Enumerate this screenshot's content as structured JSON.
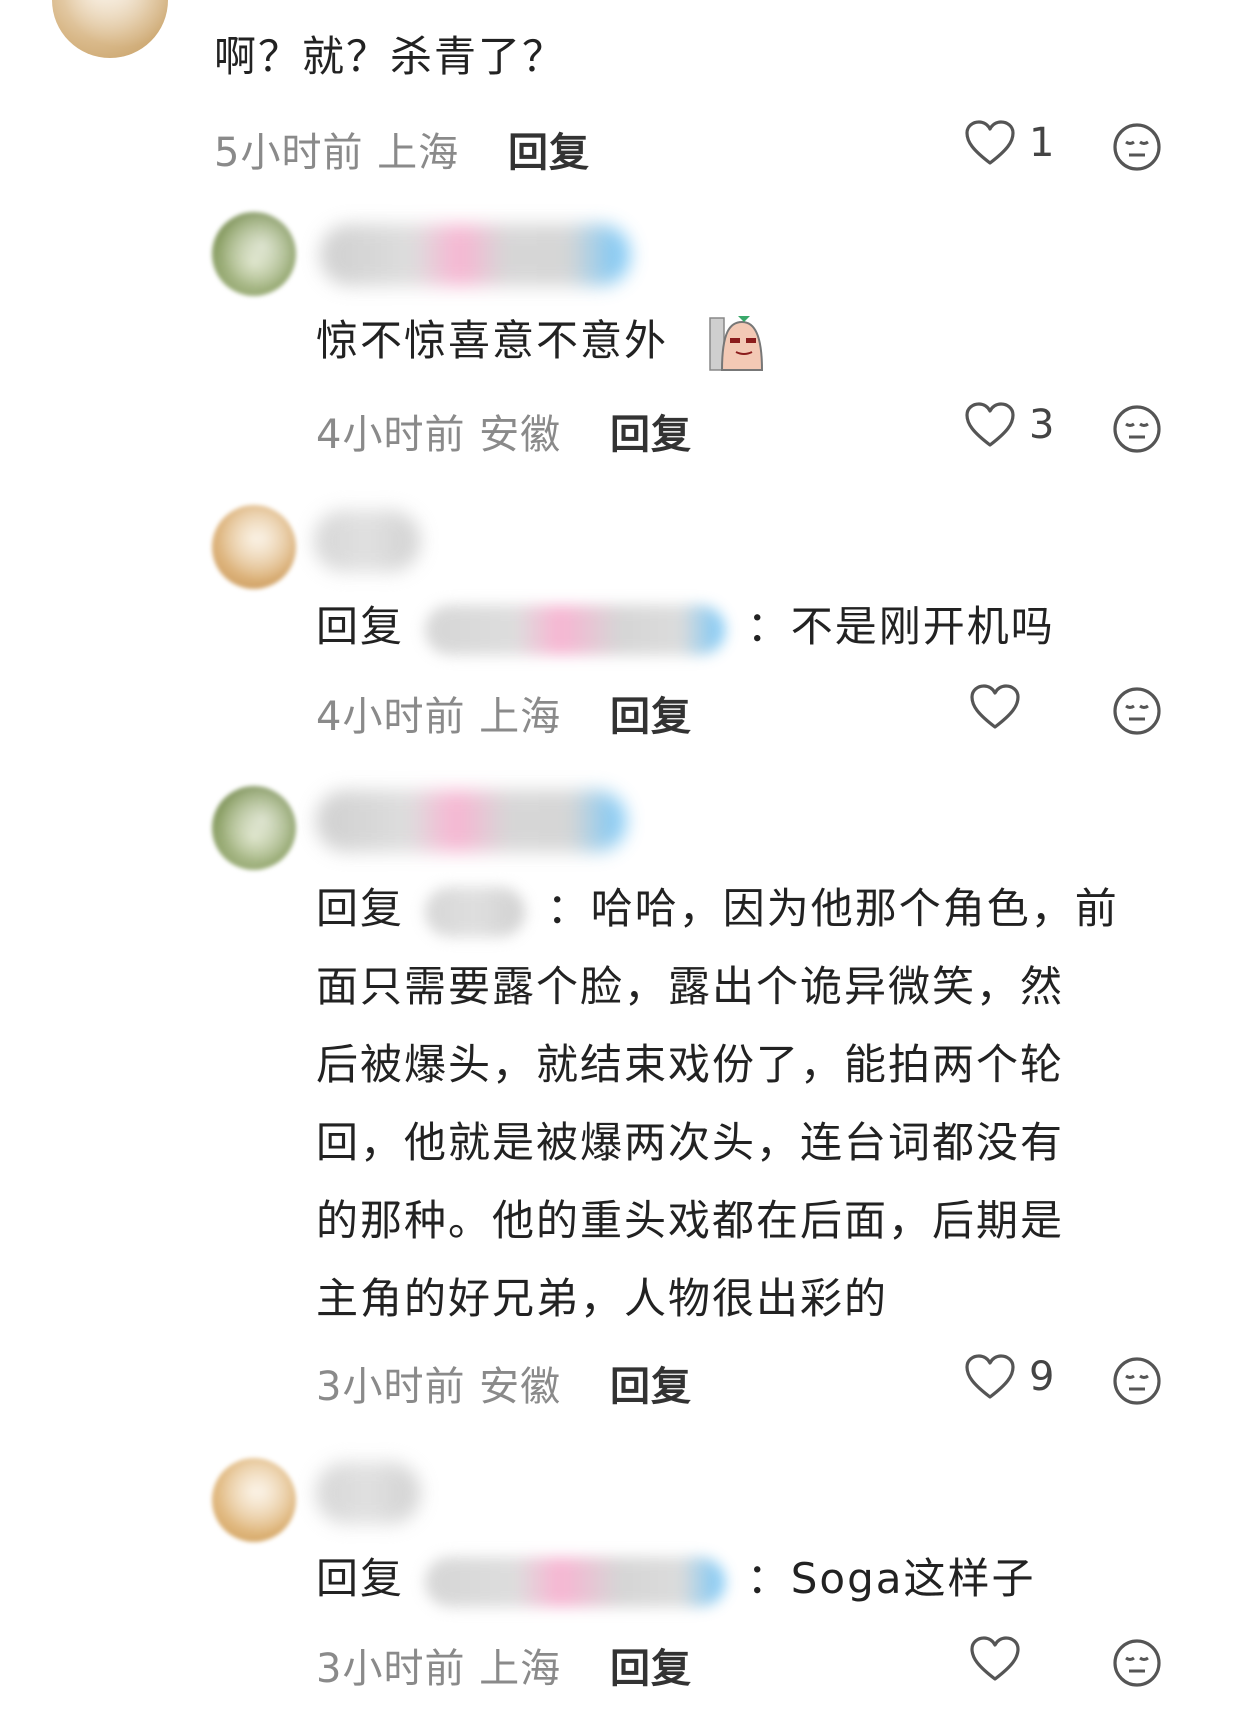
{
  "comments": [
    {
      "text": "啊？就？杀青了？",
      "meta": "5小时前 上海",
      "reply_label": "回复",
      "likes": "1"
    },
    {
      "text": "惊不惊喜意不意外",
      "meta": "4小时前 安徽",
      "reply_label": "回复",
      "likes": "3"
    },
    {
      "reply_prefix": "回复",
      "text": "：不是刚开机吗",
      "meta": "4小时前 上海",
      "reply_label": "回复",
      "likes": ""
    },
    {
      "reply_prefix": "回复",
      "first_line": "：哈哈，因为他那个角色，前",
      "lines": [
        "面只需要露个脸，露出个诡异微笑，然",
        "后被爆头，就结束戏份了，能拍两个轮",
        "回，他就是被爆两次头，连台词都没有",
        "的那种。他的重头戏都在后面，后期是",
        "主角的好兄弟，人物很出彩的"
      ],
      "meta": "3小时前 安徽",
      "reply_label": "回复",
      "likes": "9"
    },
    {
      "reply_prefix": "回复",
      "text": "：Soga这样子",
      "meta": "3小时前 上海",
      "reply_label": "回复",
      "likes": ""
    }
  ],
  "icons": {
    "like": "heart-outline-icon",
    "emoji": "neutral-face-icon",
    "sticker": "sticker-icon"
  },
  "colors": {
    "meta": "#8a8a8a",
    "text": "#222222",
    "icon": "#555555"
  }
}
